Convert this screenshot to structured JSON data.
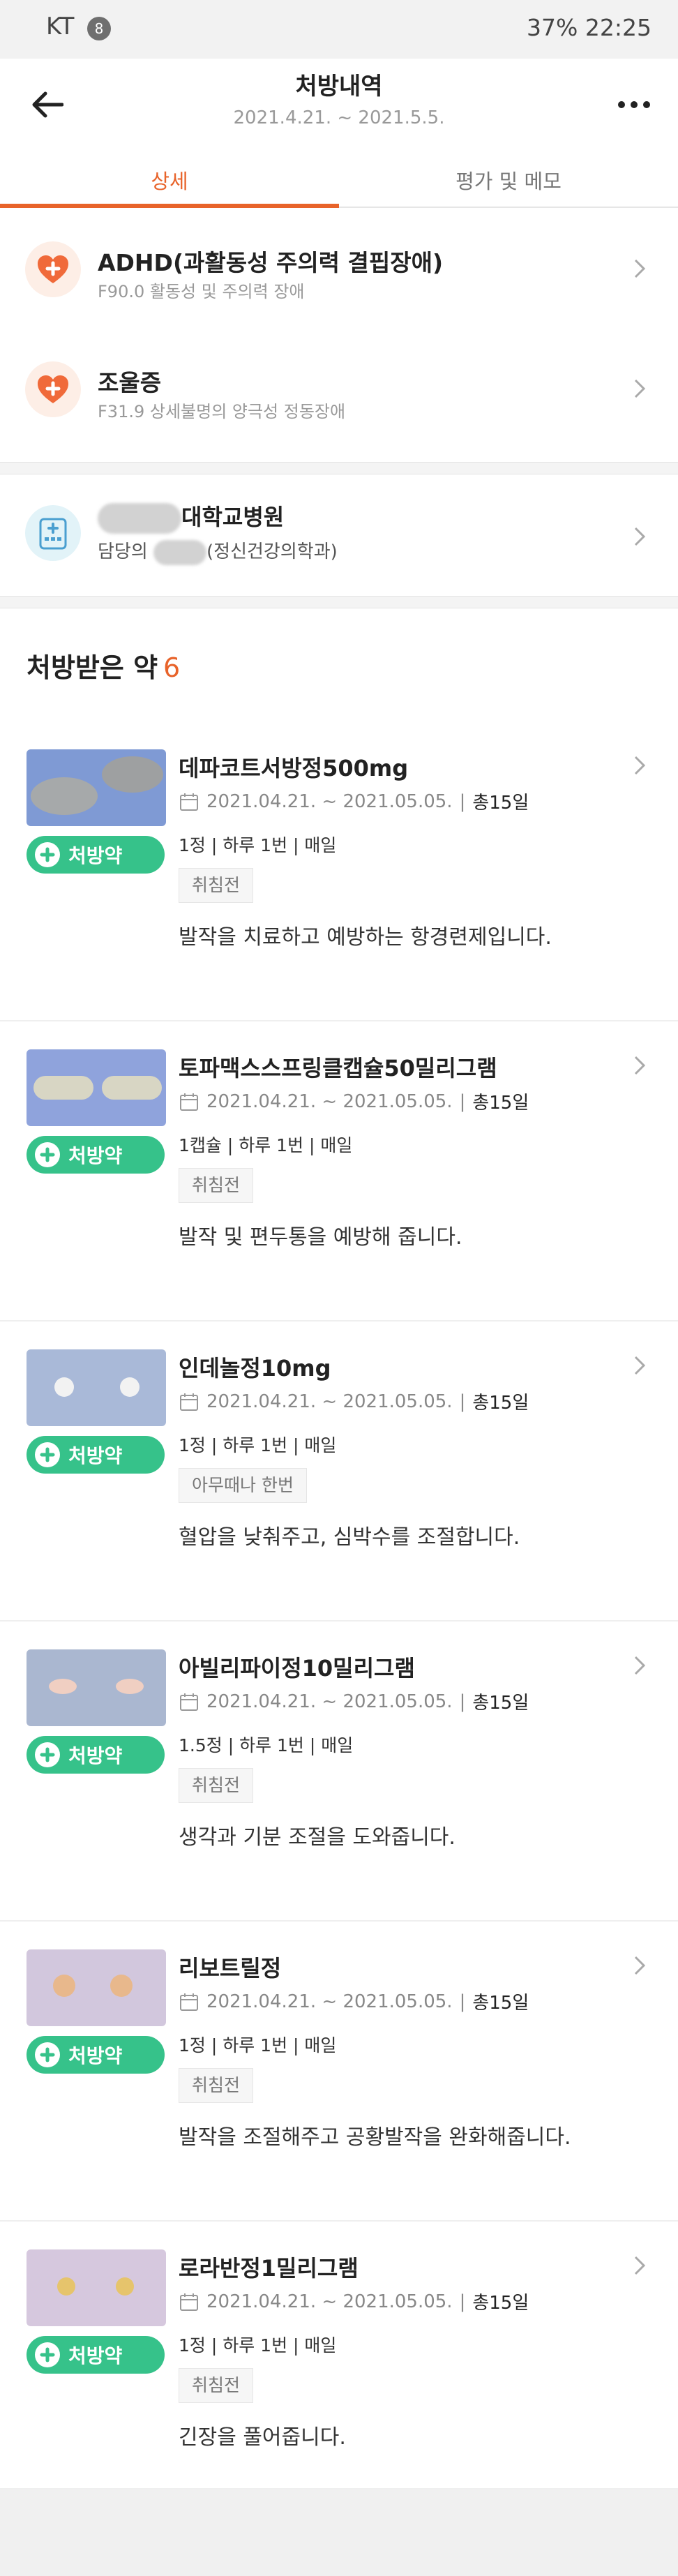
{
  "status_bar": {
    "carrier": "KT",
    "notification_count": "8",
    "battery": "37%",
    "time": "22:25"
  },
  "header": {
    "title": "처방내역",
    "period": "2021.4.21. ~ 2021.5.5."
  },
  "tabs": [
    {
      "label": "상세",
      "active": true
    },
    {
      "label": "평가 및 메모",
      "active": false
    }
  ],
  "diagnoses": [
    {
      "name": "ADHD(과활동성 주의력 결핍장애)",
      "code": "F90.0 활동성 및 주의력 장애"
    },
    {
      "name": "조울증",
      "code": "F31.9 상세불명의 양극성 정동장애"
    }
  ],
  "hospital": {
    "name_suffix": "대학교병원",
    "doctor_prefix": "담당의",
    "department": "(정신건강의학과)"
  },
  "medications_section": {
    "title": "처방받은 약",
    "count": "6"
  },
  "prescription_badge": "처방약",
  "medications": [
    {
      "name": "데파코트서방정500mg",
      "dates": "2021.04.21. ~ 2021.05.05.",
      "total": "총15일",
      "dose": "1정 | 하루 1번 | 매일",
      "timing": "취침전",
      "description": "발작을 치료하고 예방하는 항경련제입니다."
    },
    {
      "name": "토파맥스스프링클캡슐50밀리그램",
      "dates": "2021.04.21. ~ 2021.05.05.",
      "total": "총15일",
      "dose": "1캡슐 | 하루 1번 | 매일",
      "timing": "취침전",
      "description": "발작 및 편두통을 예방해 줍니다."
    },
    {
      "name": "인데놀정10mg",
      "dates": "2021.04.21. ~ 2021.05.05.",
      "total": "총15일",
      "dose": "1정 | 하루 1번 | 매일",
      "timing": "아무때나 한번",
      "description": "혈압을 낮춰주고, 심박수를 조절합니다."
    },
    {
      "name": "아빌리파이정10밀리그램",
      "dates": "2021.04.21. ~ 2021.05.05.",
      "total": "총15일",
      "dose": "1.5정 | 하루 1번 | 매일",
      "timing": "취침전",
      "description": "생각과 기분 조절을 도와줍니다."
    },
    {
      "name": "리보트릴정",
      "dates": "2021.04.21. ~ 2021.05.05.",
      "total": "총15일",
      "dose": "1정 | 하루 1번 | 매일",
      "timing": "취침전",
      "description": "발작을 조절해주고 공황발작을 완화해줍니다."
    },
    {
      "name": "로라반정1밀리그램",
      "dates": "2021.04.21. ~ 2021.05.05.",
      "total": "총15일",
      "dose": "1정 | 하루 1번 | 매일",
      "timing": "취침전",
      "description": "긴장을 풀어줍니다."
    }
  ],
  "colors": {
    "accent": "#e8632a",
    "rx_green": "#36c28a",
    "separator": "#f4f4f4"
  }
}
